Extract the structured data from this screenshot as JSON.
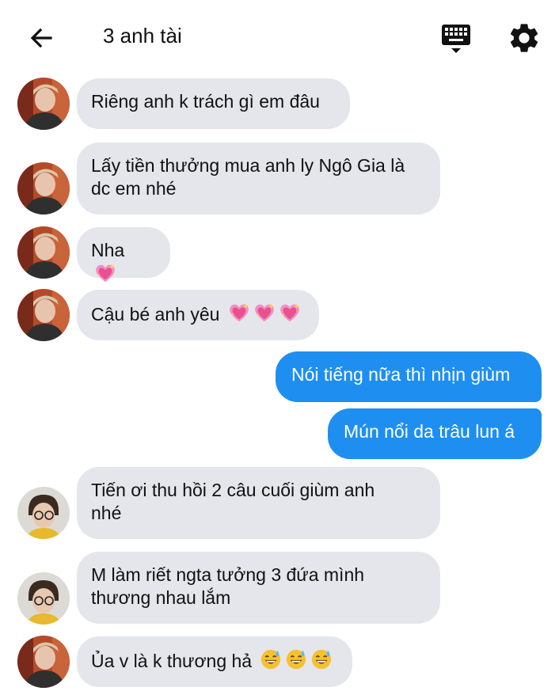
{
  "header": {
    "back_icon": "arrow-left-icon",
    "title": "3 anh tài",
    "keyboard_icon": "keyboard-icon",
    "settings_icon": "gear-icon"
  },
  "messages": [
    {
      "side": "in",
      "avatar": "person-a",
      "text": "Riêng anh k trách gì em đâu",
      "emoji": []
    },
    {
      "side": "in",
      "avatar": "person-a",
      "line1": "Lấy tiền thưởng mua anh ly Ngô Gia là",
      "line2": "dc em nhé",
      "emoji": []
    },
    {
      "side": "in",
      "avatar": "person-a",
      "text": "Nha",
      "emoji": [
        "sparkling-heart"
      ]
    },
    {
      "side": "in",
      "avatar": "person-a",
      "text": "Cậu bé anh yêu",
      "emoji": [
        "sparkling-heart",
        "sparkling-heart",
        "sparkling-heart"
      ]
    },
    {
      "side": "out",
      "text": "Nói tiếng nữa thì nhịn giùm"
    },
    {
      "side": "out",
      "text": "Mún nổi da trâu lun á"
    },
    {
      "side": "in",
      "avatar": "person-b",
      "line1": "Tiến ơi thu hồi 2 câu cuối giùm anh",
      "line2": "nhé",
      "emoji": []
    },
    {
      "side": "in",
      "avatar": "person-b",
      "line1": "M làm riết ngta tưởng 3 đứa mình",
      "line2": "thương nhau lắm",
      "emoji": []
    },
    {
      "side": "in",
      "avatar": "person-a",
      "text": "Ủa v là k thương hả",
      "emoji": [
        "grinning-sweat",
        "grinning-sweat",
        "grinning-sweat"
      ]
    }
  ],
  "colors": {
    "incoming_bubble": "#e4e6eb",
    "outgoing_bubble": "#1e8ff0"
  }
}
